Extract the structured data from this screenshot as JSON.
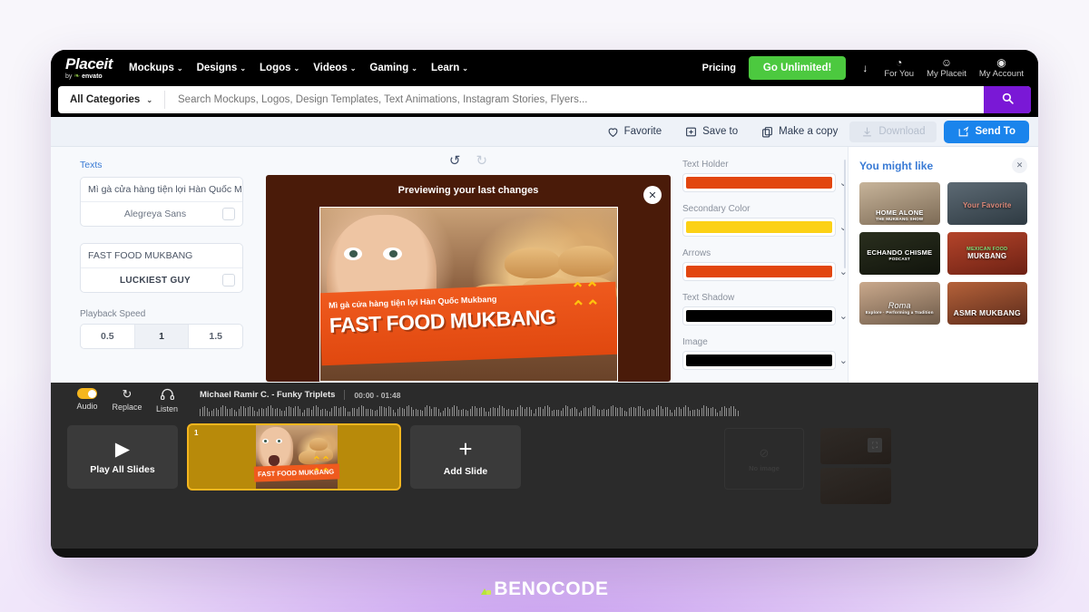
{
  "header": {
    "logo_main": "Placeit",
    "logo_by": "by",
    "logo_brand": "envato",
    "nav": [
      {
        "label": "Mockups",
        "caret": "⌄"
      },
      {
        "label": "Designs",
        "caret": "⌄"
      },
      {
        "label": "Logos",
        "caret": "⌄"
      },
      {
        "label": "Videos",
        "caret": "⌄"
      },
      {
        "label": "Gaming",
        "caret": "⌄"
      },
      {
        "label": "Learn",
        "caret": "⌄"
      }
    ],
    "pricing": "Pricing",
    "go_unlimited": "Go Unlimited!",
    "download_arrow": "↓",
    "account_items": [
      {
        "icon": "◔",
        "label": "For You"
      },
      {
        "icon": "☺",
        "label": "My Placeit"
      },
      {
        "icon": "◉",
        "label": "My Account"
      }
    ]
  },
  "search": {
    "category": "All Categories",
    "category_caret": "⌄",
    "placeholder": "Search Mockups, Logos, Design Templates, Text Animations, Instagram Stories, Flyers...",
    "value": "",
    "button_icon": "search-icon"
  },
  "actions": {
    "favorite": "Favorite",
    "save_to": "Save to",
    "make_copy": "Make a copy",
    "download": "Download",
    "send_to": "Send To"
  },
  "left_panel": {
    "section_title": "Texts",
    "texts": [
      {
        "value": "Mì gà cửa hàng tiện lợi Hàn Quốc Mu",
        "font": "Alegreya Sans",
        "style": "normal"
      },
      {
        "value": "FAST FOOD MUKBANG",
        "font": "LUCKIEST GUY",
        "style": "luckiest"
      }
    ],
    "playback_label": "Playback Speed",
    "playback_options": [
      "0.5",
      "1",
      "1.5"
    ],
    "playback_selected": "1"
  },
  "canvas": {
    "undo_icon": "↺",
    "redo_icon": "↻",
    "preview_label": "Previewing your last changes",
    "close_icon": "✕",
    "slide_subtitle": "Mì gà cửa hàng tiện lợi Hàn Quốc Mukbang",
    "slide_title": "FAST FOOD MUKBANG",
    "chevrons": "⌃⌃"
  },
  "right_panel": {
    "properties": [
      {
        "label": "Text Holder",
        "color": "#e2460f",
        "caret": "⌄"
      },
      {
        "label": "Secondary Color",
        "color": "#fcd116",
        "caret": "⌄"
      },
      {
        "label": "Arrows",
        "color": "#e2460f",
        "caret": "⌄"
      },
      {
        "label": "Text Shadow",
        "color": "#000000",
        "caret": "⌄"
      },
      {
        "label": "Image",
        "color": "#000000",
        "caret": "⌄"
      }
    ]
  },
  "suggestions": {
    "title": "You might like",
    "close_icon": "✕",
    "cards": [
      {
        "caption": "HOME ALONE",
        "sub": "THE MUKBANG SHOW",
        "bg": "linear-gradient(165deg,#c7b49a,#7c6a55)"
      },
      {
        "caption": "Your Favorite",
        "sub": "",
        "bg": "linear-gradient(165deg,#5d6a74,#2e3a42)"
      },
      {
        "caption": "ECHANDO CHISME",
        "sub": "PODCAST",
        "bg": "linear-gradient(165deg,#2a2f1e,#11140c)"
      },
      {
        "caption": "MEXICAN FOOD",
        "sub": "MUKBANG",
        "bg": "linear-gradient(165deg,#b4442a,#6d2114)"
      },
      {
        "caption": "Roma",
        "sub": "Explore · Performing a Tradition",
        "bg": "linear-gradient(165deg,#caa98c,#6d5a49)"
      },
      {
        "caption": "ASMR MUKBANG",
        "sub": "",
        "bg": "linear-gradient(165deg,#b5623a,#5b2a1a)"
      }
    ]
  },
  "timeline": {
    "audio_label": "Audio",
    "replace_label": "Replace",
    "replace_icon": "↻",
    "listen_label": "Listen",
    "listen_icon": "🎧",
    "song": "Michael Ramir C. - Funky Triplets",
    "time": "00:00 - 01:48",
    "play_all_icon": "▶",
    "play_all_label": "Play All Slides",
    "add_slide_icon": "+",
    "add_slide_label": "Add Slide",
    "slide_number": "1",
    "slide_caption": "FAST FOOD MUKBANG",
    "ghost_no_image": "No image",
    "ghost_no_image_icon": "⊘",
    "ghost_crop_icon": "⛶"
  },
  "watermark": {
    "text": "BENOCODE"
  }
}
